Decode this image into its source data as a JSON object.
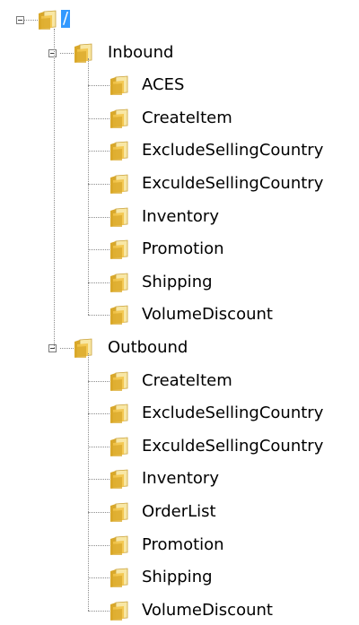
{
  "tree": {
    "root": {
      "label": "/",
      "selected": true,
      "expanded": true
    },
    "groups": [
      {
        "label": "Inbound",
        "expanded": true,
        "items": [
          "ACES",
          "CreateItem",
          "ExcludeSellingCountry",
          "ExculdeSellingCountry",
          "Inventory",
          "Promotion",
          "Shipping",
          "VolumeDiscount"
        ]
      },
      {
        "label": "Outbound",
        "expanded": true,
        "items": [
          "CreateItem",
          "ExcludeSellingCountry",
          "ExculdeSellingCountry",
          "Inventory",
          "OrderList",
          "Promotion",
          "Shipping",
          "VolumeDiscount"
        ]
      }
    ]
  },
  "colors": {
    "selection": "#3399ff",
    "folder_light": "#f8e7a5",
    "folder_dark": "#d9a82a",
    "connector": "#8c8c8c"
  },
  "icons": {
    "node": "folder-icon",
    "toggle": "collapse-minus-icon"
  }
}
